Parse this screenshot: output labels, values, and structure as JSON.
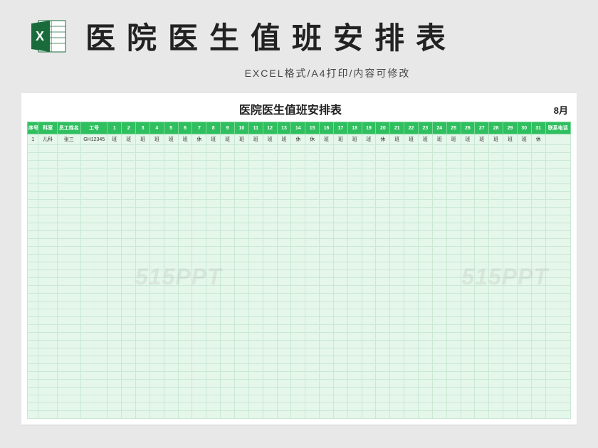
{
  "header": {
    "main_title": "医院医生值班安排表",
    "subtitle": "EXCEL格式/A4打印/内容可修改"
  },
  "sheet": {
    "title": "医院医生值班安排表",
    "month": "8月",
    "cols": {
      "seq": "序号",
      "dept": "科室",
      "name": "员工姓名",
      "id": "工号",
      "phone": "联系电话"
    },
    "days": [
      "1",
      "2",
      "3",
      "4",
      "5",
      "6",
      "7",
      "8",
      "9",
      "10",
      "11",
      "12",
      "13",
      "14",
      "15",
      "16",
      "17",
      "18",
      "19",
      "20",
      "21",
      "22",
      "23",
      "24",
      "25",
      "26",
      "27",
      "28",
      "29",
      "30",
      "31"
    ],
    "row": {
      "seq": "1",
      "dept": "儿科",
      "name": "张三",
      "id": "GH12345",
      "shifts": [
        "班",
        "班",
        "班",
        "班",
        "班",
        "班",
        "休",
        "班",
        "班",
        "班",
        "班",
        "班",
        "班",
        "休",
        "休",
        "班",
        "班",
        "班",
        "班",
        "休",
        "班",
        "班",
        "班",
        "班",
        "班",
        "班",
        "班",
        "班",
        "班",
        "班",
        "休"
      ],
      "phone": ""
    }
  },
  "watermark": "515PPT"
}
